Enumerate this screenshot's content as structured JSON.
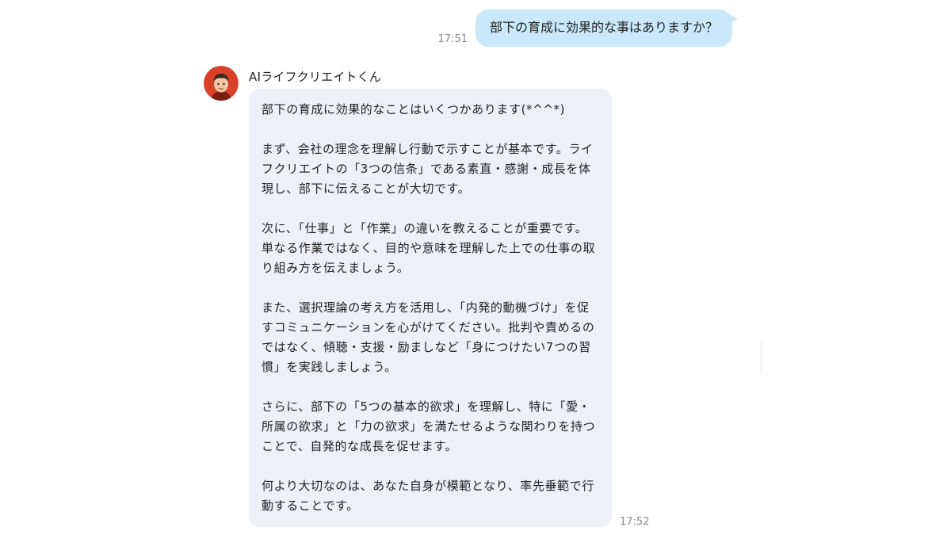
{
  "user_message": {
    "text": "部下の育成に効果的な事はありますか？",
    "time": "17:51"
  },
  "bot": {
    "name": "AIライフクリエイトくん",
    "avatar_icon": "avatar-face-icon",
    "time": "17:52",
    "paragraphs": [
      "部下の育成に効果的なことはいくつかあります(*^^*)",
      "まず、会社の理念を理解し行動で示すことが基本です。ライフクリエイトの「3つの信条」である素直・感謝・成長を体現し、部下に伝えることが大切です。",
      "次に、「仕事」と「作業」の違いを教えることが重要です。単なる作業ではなく、目的や意味を理解した上での仕事の取り組み方を伝えましょう。",
      "また、選択理論の考え方を活用し、「内発的動機づけ」を促すコミュニケーションを心がけてください。批判や責めるのではなく、傾聴・支援・励ましなど「身につけたい7つの習慣」を実践しましょう。",
      "さらに、部下の「5つの基本的欲求」を理解し、特に「愛・所属の欲求」と「力の欲求」を満たせるような関わりを持つことで、自発的な成長を促せます。",
      "何より大切なのは、あなた自身が模範となり、率先垂範で行動することです。"
    ]
  },
  "colors": {
    "user_bubble": "#c9e9fb",
    "bot_bubble": "#eef0f8",
    "timestamp": "#8a8a8a",
    "avatar_bg": "#d8402a"
  }
}
